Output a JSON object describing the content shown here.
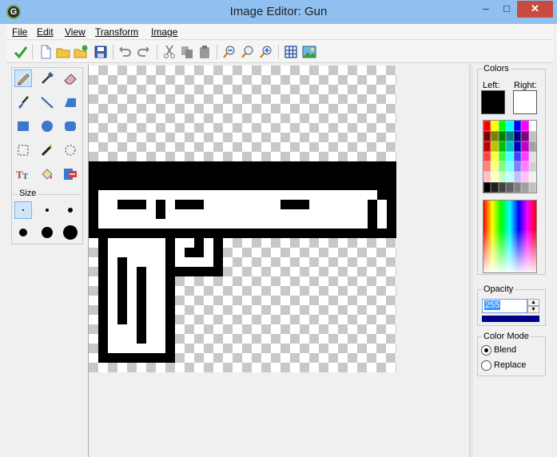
{
  "window": {
    "title": "Image Editor: Gun",
    "app_icon_glyph": "G",
    "min_glyph": "–",
    "max_glyph": "□",
    "close_glyph": "✕"
  },
  "menu": [
    "File",
    "Edit",
    "View",
    "Transform",
    "Image"
  ],
  "toolbar": {
    "icons": [
      "checkmark-icon",
      "new-file-icon",
      "open-folder-icon",
      "add-folder-icon",
      "save-icon",
      "undo-icon",
      "redo-icon",
      "cut-icon",
      "copy-icon",
      "paste-icon",
      "zoom-out-icon",
      "zoom-reset-icon",
      "zoom-in-icon",
      "grid-icon",
      "image-properties-icon"
    ]
  },
  "tools": {
    "items": [
      "pencil-icon",
      "eyedropper-icon",
      "eraser-icon",
      "paint-brush-icon",
      "line-icon",
      "polygon-icon",
      "rectangle-icon",
      "ellipse-icon",
      "rounded-rectangle-icon",
      "rectangle-select-icon",
      "magic-wand-icon",
      "ellipse-select-icon",
      "text-icon",
      "fill-bucket-icon",
      "replace-color-icon"
    ],
    "selected": "pencil-icon"
  },
  "size": {
    "label": "Size",
    "options": [
      1,
      2,
      3,
      4,
      5,
      6
    ],
    "selected": 1
  },
  "colors": {
    "title": "Colors",
    "left_label": "Left:",
    "right_label": "Right:",
    "left_color": "#000000",
    "right_color": "#ffffff",
    "palette": [
      "#ff0000",
      "#ffff00",
      "#00ff00",
      "#00ffff",
      "#0000ff",
      "#ff00ff",
      "#ffffff",
      "#800000",
      "#808000",
      "#008000",
      "#008080",
      "#000080",
      "#800080",
      "#c0c0c0",
      "#c00000",
      "#c0c000",
      "#00c000",
      "#00c0c0",
      "#0000c0",
      "#c000c0",
      "#a0a0a0",
      "#ff4040",
      "#ffff40",
      "#40ff40",
      "#40ffff",
      "#4040ff",
      "#ff40ff",
      "#e0e0e0",
      "#ff8080",
      "#ffff80",
      "#80ff80",
      "#80ffff",
      "#8080ff",
      "#ff80ff",
      "#d0d0d0",
      "#ffc0c0",
      "#ffffc0",
      "#c0ffc0",
      "#c0ffff",
      "#c0c0ff",
      "#ffc0ff",
      "#f0f0f0",
      "#000000",
      "#202020",
      "#404040",
      "#606060",
      "#808080",
      "#a0a0a0",
      "#c0c0c0"
    ]
  },
  "opacity": {
    "title": "Opacity",
    "value": "255",
    "level": 1.0,
    "up_glyph": "▲",
    "down_glyph": "▼"
  },
  "color_mode": {
    "title": "Color Mode",
    "options": [
      "Blend",
      "Replace"
    ],
    "selected": "Blend"
  }
}
